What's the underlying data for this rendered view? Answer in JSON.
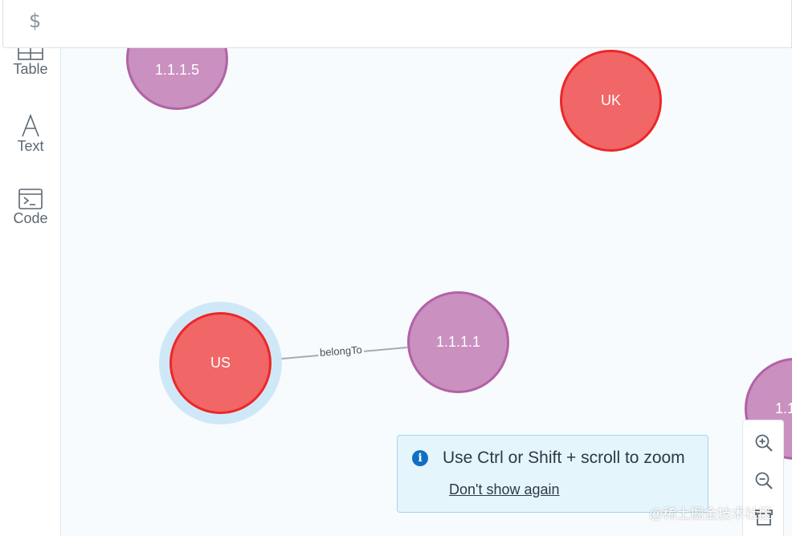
{
  "command_bar": {
    "prompt": "$"
  },
  "sidebar": {
    "items": [
      {
        "label": "Table",
        "icon": "table-icon"
      },
      {
        "label": "Text",
        "icon": "text-icon"
      },
      {
        "label": "Code",
        "icon": "code-icon"
      }
    ]
  },
  "graph": {
    "nodes": [
      {
        "label": "1.1.1.5",
        "type": "ip"
      },
      {
        "label": "UK",
        "type": "country"
      },
      {
        "label": "US",
        "type": "country",
        "selected": true
      },
      {
        "label": "1.1.1.1",
        "type": "ip"
      },
      {
        "label": "1.1",
        "type": "ip"
      }
    ],
    "edges": [
      {
        "label": "belongTo",
        "from": "1.1.1.1",
        "to": "US"
      }
    ],
    "colors": {
      "ip_fill": "#c990c0",
      "ip_border": "#b261a5",
      "country_fill": "#f16667",
      "country_border": "#eb2728",
      "selection_halo": "#cfe8f8"
    }
  },
  "zoom_hint": {
    "message": "Use Ctrl or Shift + scroll to zoom",
    "dismiss_label": "Don't show again"
  },
  "zoom_controls": {
    "items": [
      "zoom-in-icon",
      "zoom-out-icon",
      "fit-view-icon"
    ]
  },
  "watermark": "@稀土掘金技术社区"
}
